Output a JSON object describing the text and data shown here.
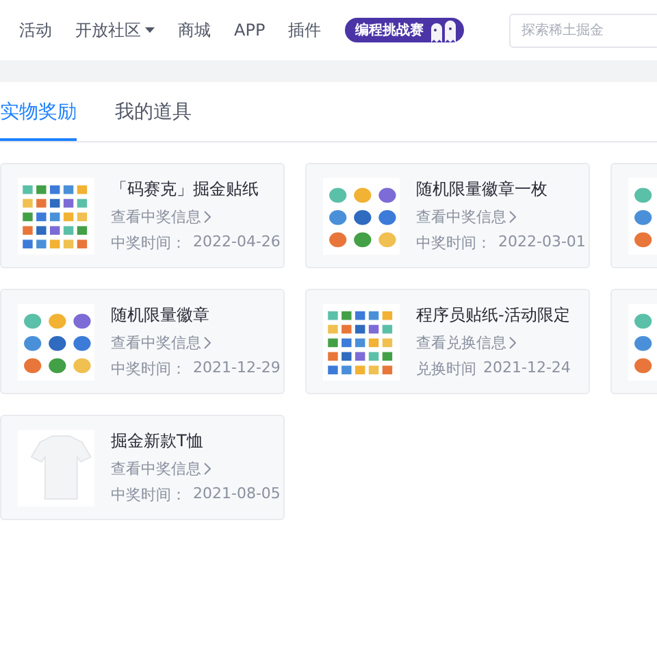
{
  "nav": {
    "items": [
      {
        "label": "活动",
        "dropdown": false
      },
      {
        "label": "开放社区",
        "dropdown": true
      },
      {
        "label": "商城",
        "dropdown": false
      },
      {
        "label": "APP",
        "dropdown": false
      },
      {
        "label": "插件",
        "dropdown": false
      }
    ],
    "badge": "编程挑战赛",
    "search": {
      "placeholder": "探索稀土掘金"
    }
  },
  "tabs": [
    {
      "label": "实物奖励",
      "selected": true
    },
    {
      "label": "我的道具",
      "selected": false
    }
  ],
  "cards": [
    {
      "kind": "full",
      "photo": {
        "kind": "stickers"
      },
      "title": "「码赛克」掘金贴纸",
      "link": "查看中奖信息",
      "time_label": "中奖时间：",
      "time": "2022-04-26"
    },
    {
      "kind": "full",
      "photo": {
        "kind": "badges"
      },
      "title": "随机限量徽章一枚",
      "link": "查看中奖信息",
      "time_label": "中奖时间：",
      "time": "2022-03-01"
    },
    {
      "kind": "partial",
      "photo": {
        "kind": "badges"
      }
    },
    {
      "kind": "full",
      "photo": {
        "kind": "badges"
      },
      "title": "随机限量徽章",
      "link": "查看中奖信息",
      "time_label": "中奖时间：",
      "time": "2021-12-29"
    },
    {
      "kind": "full",
      "photo": {
        "kind": "stickers"
      },
      "title": "程序员贴纸-活动限定",
      "link": "查看兑换信息",
      "time_label": "兑换时间",
      "time": "2021-12-24"
    },
    {
      "kind": "partial",
      "photo": {
        "kind": "pins"
      }
    },
    {
      "kind": "full",
      "photo": {
        "kind": "tshirt"
      },
      "title": "掘金新款T恤",
      "link": "查看中奖信息",
      "time_label": "中奖时间：",
      "time": "2021-08-05"
    }
  ]
}
